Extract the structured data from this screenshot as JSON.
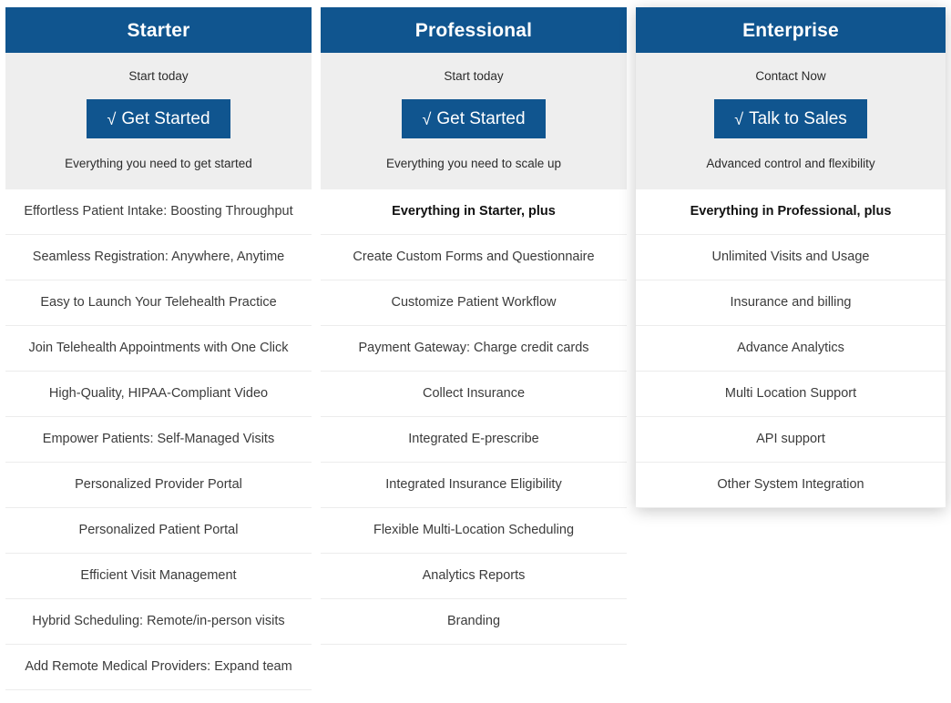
{
  "accent_color": "#10558f",
  "header_text_color": "#ffffff",
  "intro_background": "#eeeeee",
  "row_background": "#ffffff",
  "row_divider_color": "#ececec",
  "plans": [
    {
      "name": "Starter",
      "price_note": "Start today",
      "cta_glyph": "√",
      "cta_label": "Get Started",
      "tagline": "Everything you need to get started",
      "features": [
        "Effortless Patient Intake: Boosting Throughput",
        "Seamless Registration: Anywhere, Anytime",
        "Easy to Launch Your Telehealth Practice",
        "Join Telehealth Appointments with One Click",
        "High-Quality, HIPAA-Compliant Video",
        "Empower Patients: Self-Managed Visits",
        "Personalized Provider Portal",
        "Personalized Patient Portal",
        "Efficient Visit Management",
        "Hybrid Scheduling: Remote/in-person visits",
        "Add Remote Medical Providers: Expand team"
      ],
      "emphasis_first_feature": false
    },
    {
      "name": "Professional",
      "price_note": "Start today",
      "cta_glyph": "√",
      "cta_label": "Get Started",
      "tagline": "Everything you need to scale up",
      "features": [
        "Everything in Starter, plus",
        "Create Custom Forms and Questionnaire",
        "Customize Patient Workflow",
        "Payment Gateway: Charge credit cards",
        "Collect Insurance",
        "Integrated E-prescribe",
        "Integrated Insurance Eligibility",
        "Flexible Multi-Location Scheduling",
        "Analytics Reports",
        "Branding"
      ],
      "emphasis_first_feature": true
    },
    {
      "name": "Enterprise",
      "price_note": "Contact Now",
      "cta_glyph": "√",
      "cta_label": "Talk to Sales",
      "tagline": "Advanced control and flexibility",
      "features": [
        "Everything in Professional, plus",
        "Unlimited Visits and Usage",
        "Insurance and billing",
        "Advance Analytics",
        "Multi Location Support",
        "API support",
        "Other System Integration"
      ],
      "emphasis_first_feature": true
    }
  ]
}
